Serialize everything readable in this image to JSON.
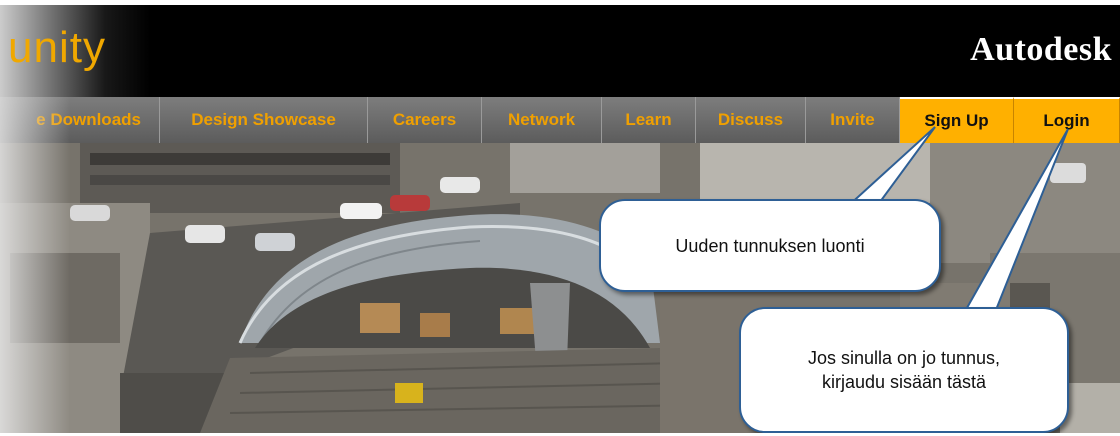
{
  "header": {
    "community_title": "unity",
    "brand": "Autodesk"
  },
  "nav": {
    "items": [
      {
        "label": "e Downloads",
        "active": false
      },
      {
        "label": "Design Showcase",
        "active": false
      },
      {
        "label": "Careers",
        "active": false
      },
      {
        "label": "Network",
        "active": false
      },
      {
        "label": "Learn",
        "active": false
      },
      {
        "label": "Discuss",
        "active": false
      },
      {
        "label": "Invite",
        "active": false
      },
      {
        "label": "Sign Up",
        "active": true
      },
      {
        "label": "Login",
        "active": true
      }
    ]
  },
  "callouts": {
    "signup": "Uuden tunnuksen luonti",
    "login_line1": "Jos sinulla on jo tunnus,",
    "login_line2": "kirjaudu sisään tästä"
  },
  "colors": {
    "accent": "#ffb000",
    "nav_text": "#f0a000",
    "callout_border": "#2e5f95"
  },
  "photo": {
    "icon": "building-construction-photo"
  }
}
